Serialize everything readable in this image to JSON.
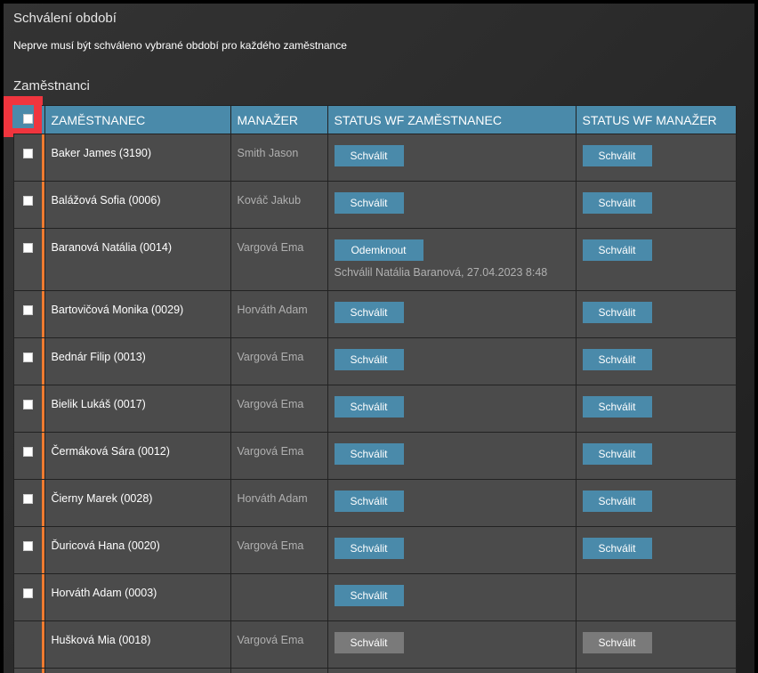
{
  "title": "Schválení období",
  "subtitle": "Neprve musí být schváleno vybrané období pro každého zaměstnance",
  "section": "Zaměstnanci",
  "columns": [
    "ZAMĚSTNANEC",
    "MANAŽER",
    "STATUS WF ZAMĚSTNANEC",
    "STATUS WF MANAŽER"
  ],
  "rows": [
    {
      "employee": "Baker James (3190)",
      "manager": "Smith Jason",
      "emp_btn": "Schválit",
      "mgr_btn": "Schválit"
    },
    {
      "employee": "Balážová Sofia (0006)",
      "manager": "Kováč Jakub",
      "emp_btn": "Schválit",
      "mgr_btn": "Schválit"
    },
    {
      "employee": "Baranová Natália (0014)",
      "manager": "Vargová Ema",
      "emp_btn": "Odemknout",
      "emp_note": "Schválil Natália Baranová, 27.04.2023 8:48",
      "mgr_btn": "Schválit"
    },
    {
      "employee": "Bartovičová Monika (0029)",
      "manager": "Horváth Adam",
      "emp_btn": "Schválit",
      "mgr_btn": "Schválit"
    },
    {
      "employee": "Bednár Filip (0013)",
      "manager": "Vargová Ema",
      "emp_btn": "Schválit",
      "mgr_btn": "Schválit"
    },
    {
      "employee": "Bielik Lukáš (0017)",
      "manager": "Vargová Ema",
      "emp_btn": "Schválit",
      "mgr_btn": "Schválit"
    },
    {
      "employee": "Čermáková Sára (0012)",
      "manager": "Vargová Ema",
      "emp_btn": "Schválit",
      "mgr_btn": "Schválit"
    },
    {
      "employee": "Čierny Marek (0028)",
      "manager": "Horváth Adam",
      "emp_btn": "Schválit",
      "mgr_btn": "Schválit"
    },
    {
      "employee": "Ďuricová Hana (0020)",
      "manager": "Vargová Ema",
      "emp_btn": "Schválit",
      "mgr_btn": "Schválit"
    },
    {
      "employee": "Horváth Adam (0003)",
      "manager": "",
      "emp_btn": "Schválit"
    },
    {
      "employee": "Hušková Mia (0018)",
      "manager": "Vargová Ema",
      "emp_btn": "Schválit",
      "mgr_btn": "Schválit",
      "disabled": true
    }
  ]
}
